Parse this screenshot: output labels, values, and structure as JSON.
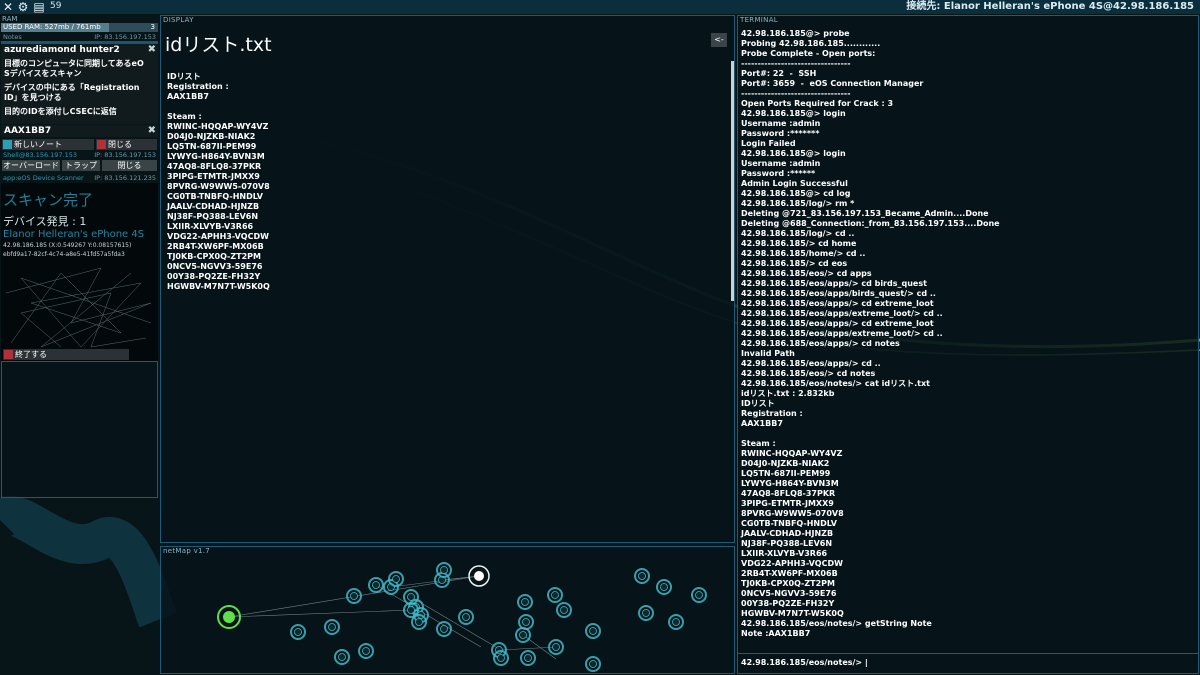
{
  "topbar": {
    "icons": [
      "close-icon",
      "gear-icon",
      "document-icon"
    ],
    "count": "59",
    "connection": "接続先: Elanor Helleran's ePhone 4S@42.98.186.185"
  },
  "ram": {
    "label": "RAM",
    "usage": "USED RAM: 527mb / 761mb",
    "slots": "3",
    "used_fraction": 0.69
  },
  "notes_exe": {
    "name": "Notes",
    "ip": "IP: 83.156.197.153"
  },
  "note1": {
    "title": "azurediamond hunter2",
    "lines": [
      "目標のコンピュータに同期してあるeO",
      "Sデバイスをスキャン",
      "デバイスの中にある「Registration",
      "ID」を見つける",
      "目的のIDを添付しCSECに返信"
    ]
  },
  "note2": {
    "title": "AAX1BB7"
  },
  "notes_buttons": {
    "new_note": "新しいノート",
    "close": "閉じる"
  },
  "shell_exe": {
    "name": "Shell@83.156.197.153",
    "ip": "IP: 83.156.197.153"
  },
  "shell_buttons": {
    "overload": "オーバーロード",
    "trap": "トラップ",
    "close": "閉じる"
  },
  "scanner_exe": {
    "name": "app:eOS Device Scanner",
    "ip": "IP: 83.156.121.235"
  },
  "scanner": {
    "status": "スキャン完了",
    "found": "デバイス発見 : 1",
    "device_name": "Elanor Helleran's ePhone 4S",
    "device_ip": "42.98.186.185  (X:0.549267 Y:0.08157615)",
    "device_id": "ebfd9a17-82cf-4c74-a8e5-41fd57a5fda3",
    "exit": "終了する"
  },
  "display": {
    "label": "DISPLAY",
    "file_name": "idリスト.txt",
    "back_label": "<-",
    "content": "IDリスト\nRegistration :\nAAX1BB7\n\nSteam :\nRWINC-HQQAP-WY4VZ\nD04J0-NJZKB-NIAK2\nLQ5TN-687II-PEM99\nLYWYG-H864Y-BVN3M\n47AQ8-8FLQ8-37PKR\n3PIPG-ETMTR-JMXX9\n8PVRG-W9WW5-070V8\nCG0TB-TNBFQ-HNDLV\nJAALV-CDHAD-HJNZB\nNJ38F-PQ388-LEV6N\nLXIIR-XLVYB-V3R66\nVDG22-APHH3-VQCDW\n2RB4T-XW6PF-MX06B\nTJ0KB-CPX0Q-ZT2PM\n0NCV5-NGVV3-59E76\n00Y38-PQ2ZE-FH32Y\nHGWBV-M7N7T-W5K0Q"
  },
  "netmap": {
    "label": "netMap v1.7"
  },
  "terminal": {
    "label": "TERMINAL",
    "content": "42.98.186.185@> probe\nProbing 42.98.186.185............\nProbe Complete - Open ports:\n---------------------------------\nPort#: 22  -  SSH\nPort#: 3659  -  eOS Connection Manager\n---------------------------------\nOpen Ports Required for Crack : 3\n42.98.186.185@> login\nUsername :admin\nPassword :*******\nLogin Failed\n42.98.186.185@> login\nUsername :admin\nPassword :******\nAdmin Login Successful\n42.98.186.185@> cd log\n42.98.186.185/log/> rm *\nDeleting @721_83.156.197.153_Became_Admin....Done\nDeleting @688_Connection:_from_83.156.197.153....Done\n42.98.186.185/log/> cd ..\n42.98.186.185/> cd home\n42.98.186.185/home/> cd ..\n42.98.186.185/> cd eos\n42.98.186.185/eos/> cd apps\n42.98.186.185/eos/apps/> cd birds_quest\n42.98.186.185/eos/apps/birds_quest/> cd ..\n42.98.186.185/eos/apps/> cd extreme_loot\n42.98.186.185/eos/apps/extreme_loot/> cd ..\n42.98.186.185/eos/apps/> cd extreme_loot\n42.98.186.185/eos/apps/extreme_loot/> cd ..\n42.98.186.185/eos/apps/> cd notes\nInvalid Path\n42.98.186.185/eos/apps/> cd ..\n42.98.186.185/eos/> cd notes\n42.98.186.185/eos/notes/> cat idリスト.txt\nidリスト.txt : 2.832kb\nIDリスト\nRegistration :\nAAX1BB7\n\nSteam :\nRWINC-HQQAP-WY4VZ\nD04J0-NJZKB-NIAK2\nLQ5TN-687II-PEM99\nLYWYG-H864Y-BVN3M\n47AQ8-8FLQ8-37PKR\n3PIPG-ETMTR-JMXX9\n8PVRG-W9WW5-070V8\nCG0TB-TNBFQ-HNDLV\nJAALV-CDHAD-HJNZB\nNJ38F-PQ388-LEV6N\nLXIIR-XLVYB-V3R66\nVDG22-APHH3-VQCDW\n2RB4T-XW6PF-MX06B\nTJ0KB-CPX0Q-ZT2PM\n0NCV5-NGVV3-59E76\n00Y38-PQ2ZE-FH32Y\nHGWBV-M7N7T-W5K0Q\n42.98.186.185/eos/notes/> getString Note\nNote :AAX1BB7",
    "prompt": "42.98.186.185/eos/notes/>  |"
  },
  "colors": {
    "accent": "#1b5d78",
    "red_button": "#b0313a",
    "teal_button": "#2b9db5",
    "node": "#3fb8c8",
    "home_node": "#5fe04a"
  }
}
